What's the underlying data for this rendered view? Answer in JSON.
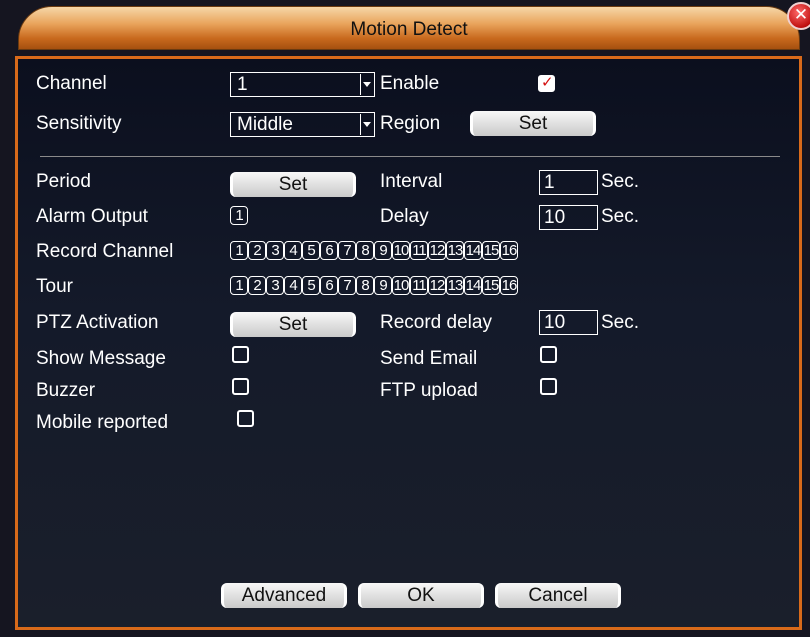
{
  "window": {
    "title": "Motion Detect",
    "close_glyph": "✕"
  },
  "channel": {
    "label": "Channel",
    "value": "1"
  },
  "enable": {
    "label": "Enable",
    "checked": true
  },
  "sensitivity": {
    "label": "Sensitivity",
    "value": "Middle"
  },
  "region": {
    "label": "Region",
    "button": "Set"
  },
  "period": {
    "label": "Period",
    "button": "Set"
  },
  "interval": {
    "label": "Interval",
    "value": "1",
    "unit": "Sec."
  },
  "alarm_output": {
    "label": "Alarm Output",
    "value": "1"
  },
  "delay": {
    "label": "Delay",
    "value": "10",
    "unit": "Sec."
  },
  "record_channel": {
    "label": "Record Channel",
    "channels": [
      "1",
      "2",
      "3",
      "4",
      "5",
      "6",
      "7",
      "8",
      "9",
      "10",
      "11",
      "12",
      "13",
      "14",
      "15",
      "16"
    ]
  },
  "tour": {
    "label": "Tour",
    "channels": [
      "1",
      "2",
      "3",
      "4",
      "5",
      "6",
      "7",
      "8",
      "9",
      "10",
      "11",
      "12",
      "13",
      "14",
      "15",
      "16"
    ]
  },
  "ptz": {
    "label": "PTZ Activation",
    "button": "Set"
  },
  "record_delay": {
    "label": "Record delay",
    "value": "10",
    "unit": "Sec."
  },
  "show_message": {
    "label": "Show Message",
    "checked": false
  },
  "send_email": {
    "label": "Send Email",
    "checked": false
  },
  "buzzer": {
    "label": "Buzzer",
    "checked": false
  },
  "ftp_upload": {
    "label": "FTP upload",
    "checked": false
  },
  "mobile_reported": {
    "label": "Mobile reported",
    "checked": false
  },
  "footer": {
    "advanced": "Advanced",
    "ok": "OK",
    "cancel": "Cancel"
  },
  "colors": {
    "accent": "#d86a1a",
    "title_gradient_top": "#f6d6a8",
    "title_gradient_bottom": "#a5500f",
    "check_tick": "#d41111"
  }
}
